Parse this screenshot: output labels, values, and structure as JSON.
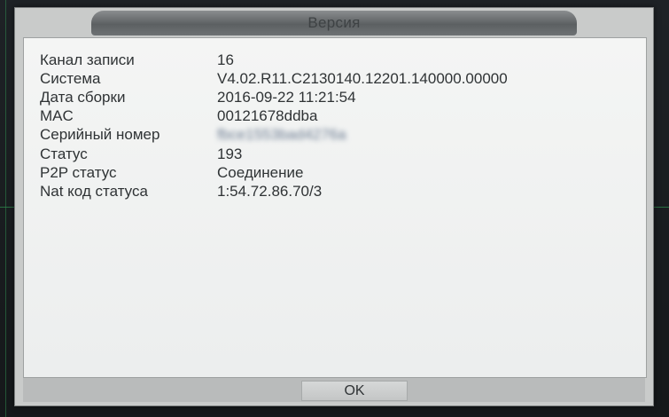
{
  "dialog": {
    "title": "Версия",
    "rows": [
      {
        "label": "Канал записи",
        "value": "16"
      },
      {
        "label": "Система",
        "value": "V4.02.R11.C2130140.12201.140000.00000"
      },
      {
        "label": "Дата сборки",
        "value": "2016-09-22 11:21:54"
      },
      {
        "label": "MAC",
        "value": "00121678ddba"
      },
      {
        "label": "Серийный номер",
        "value": "fbce1553bad4276a"
      },
      {
        "label": "Статус",
        "value": "193"
      },
      {
        "label": "P2P статус",
        "value": "Соединение"
      },
      {
        "label": "Nat код статуса",
        "value": "1:54.72.86.70/3"
      }
    ],
    "ok_label": "OK"
  },
  "colors": {
    "overlay_guide": "#2f8a4e",
    "dialog_bg": "#c9cbca",
    "content_bg": "#f0f1f0",
    "text": "#2f3335"
  }
}
